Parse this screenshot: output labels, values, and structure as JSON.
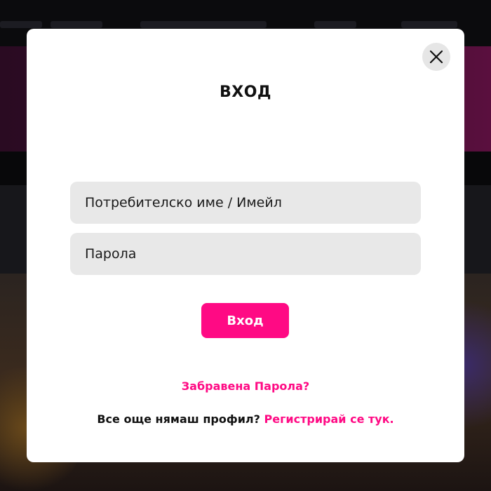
{
  "modal": {
    "title": "ВХОД",
    "close_icon": "close-icon",
    "username_placeholder": "Потребителско име / Имейл",
    "password_placeholder": "Парола",
    "login_label": "Вход",
    "forgot_label": "Забравена Парола?",
    "register_prompt": "Все още нямаш профил?",
    "register_link": "Регистрирай се тук."
  },
  "colors": {
    "accent": "#ff0a84",
    "field_bg": "#e8e8e8",
    "overlay_bg": "#0d0d10"
  }
}
